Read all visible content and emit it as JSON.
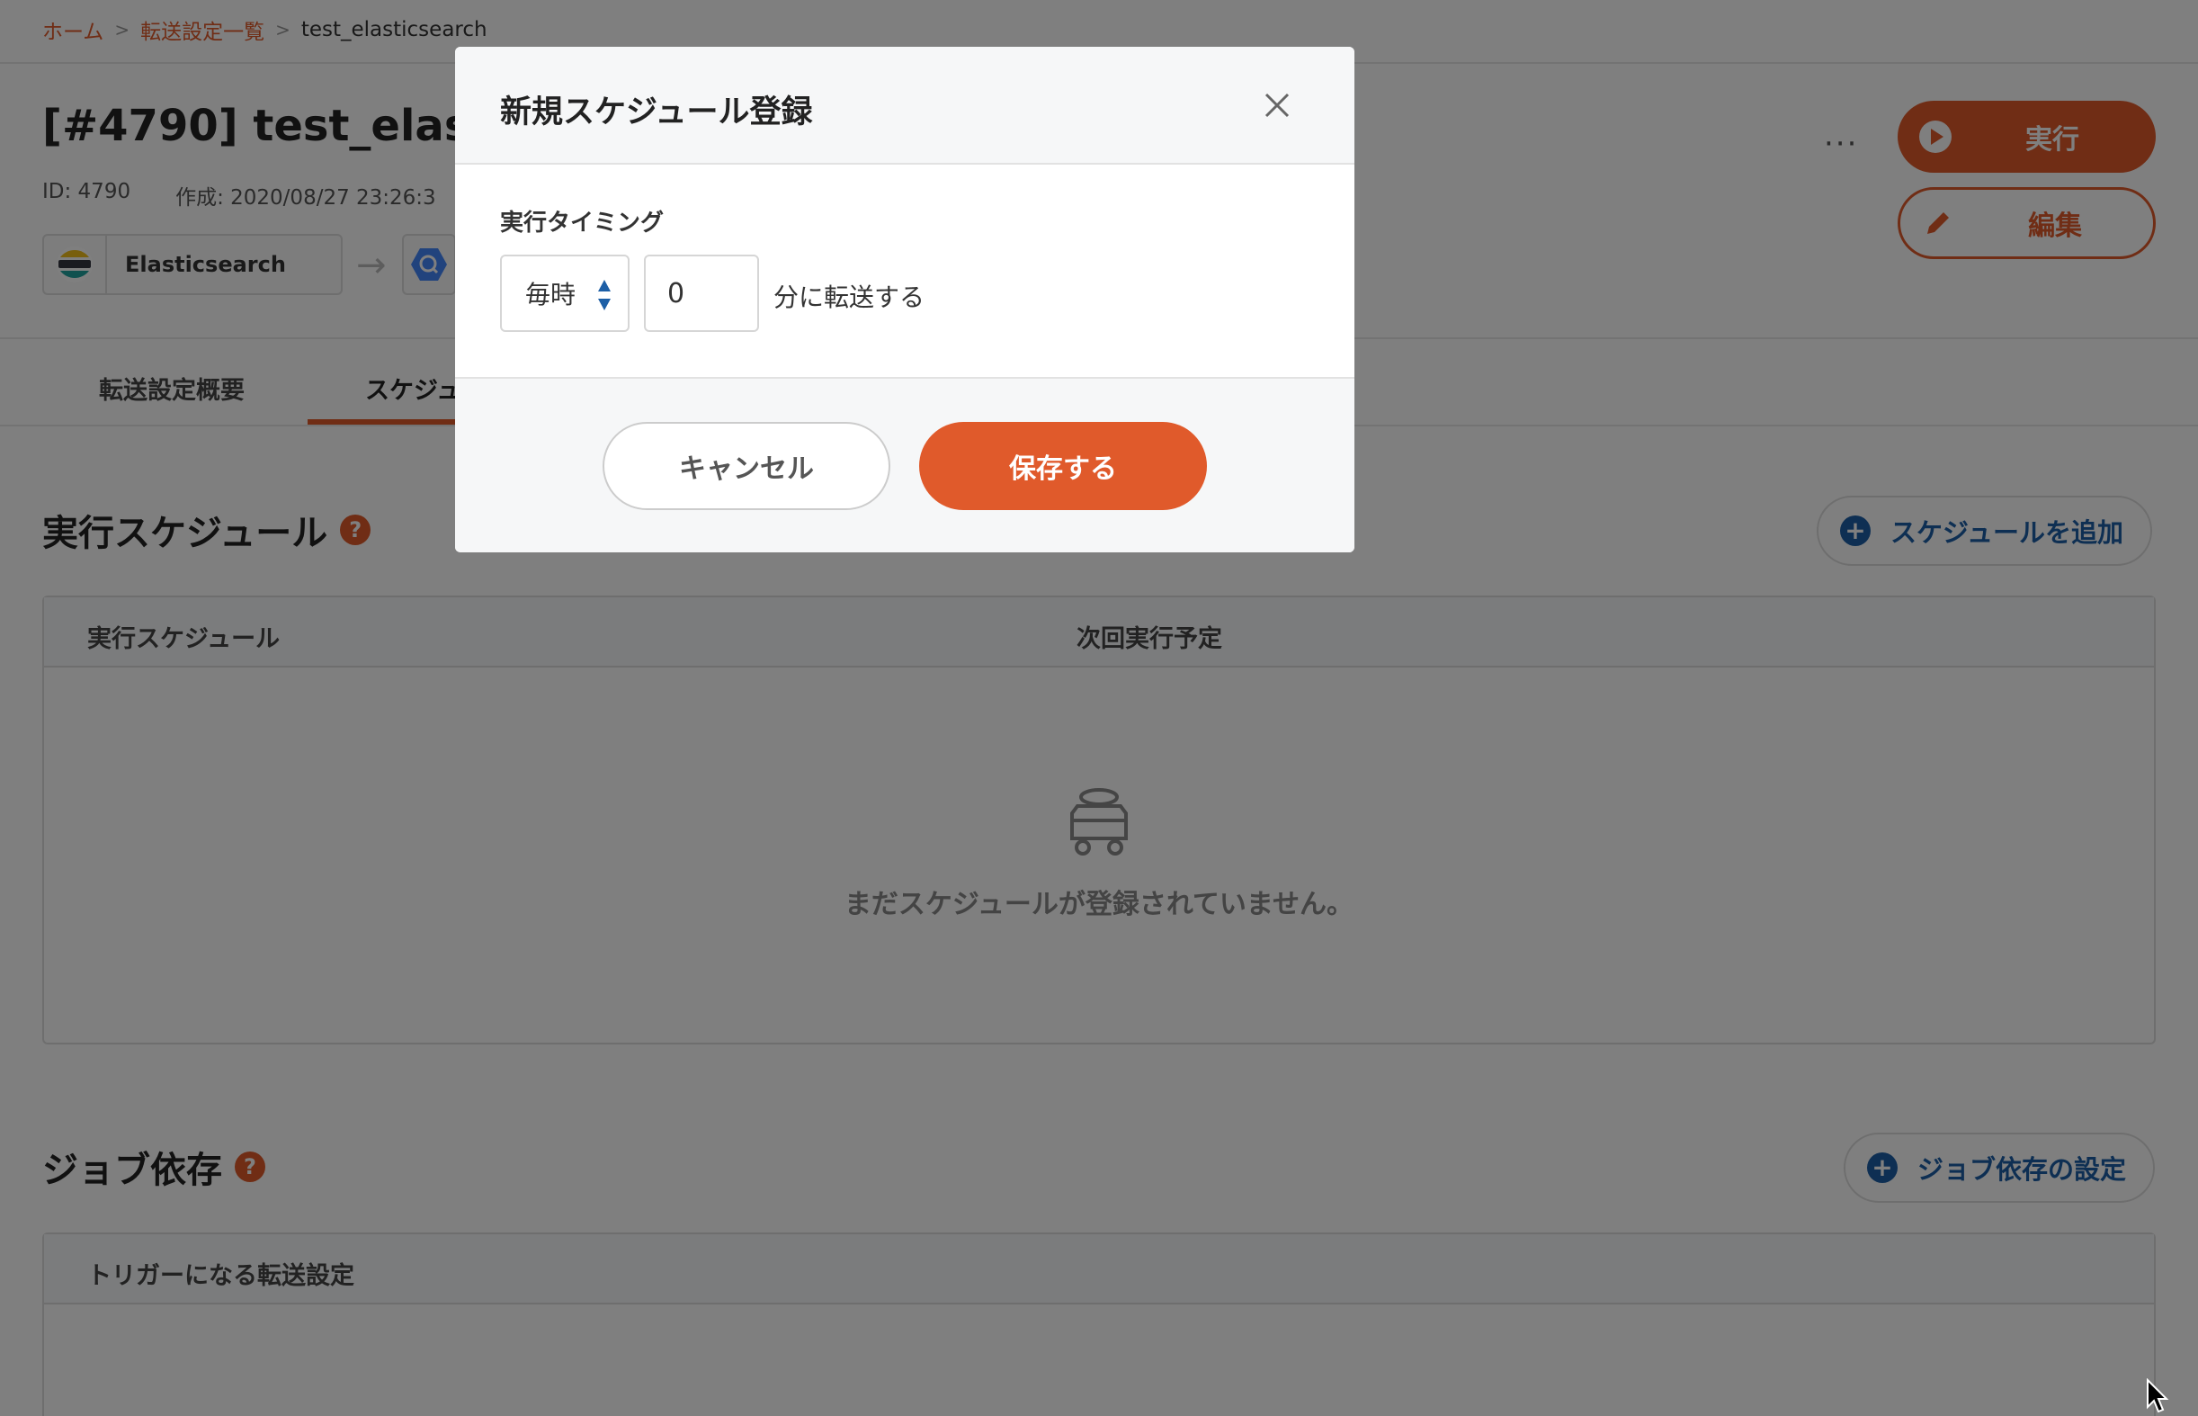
{
  "breadcrumb": {
    "home": "ホーム",
    "list": "転送設定一覧",
    "current": "test_elasticsearch",
    "separator": ">"
  },
  "header": {
    "title": "[#4790] test_elastic",
    "id_label": "ID: 4790",
    "created_label": "作成: 2020/08/27 23:26:3"
  },
  "connectors": {
    "source_label": "Elasticsearch",
    "arrow": "→"
  },
  "actions": {
    "more": "···",
    "run_label": "実行",
    "edit_label": "編集"
  },
  "tabs": [
    {
      "label": "転送設定概要",
      "active": false
    },
    {
      "label": "スケジュ",
      "active": true
    }
  ],
  "schedule_section": {
    "title": "実行スケジュール",
    "help": "?",
    "add_button": "スケジュールを追加",
    "columns": [
      "実行スケジュール",
      "次回実行予定"
    ],
    "empty_text": "まだスケジュールが登録されていません。"
  },
  "dependency_section": {
    "title": "ジョブ依存",
    "help": "?",
    "add_button": "ジョブ依存の設定",
    "columns": [
      "トリガーになる転送設定"
    ]
  },
  "modal": {
    "title": "新規スケジュール登録",
    "field_label": "実行タイミング",
    "frequency_value": "毎時",
    "minute_value": "0",
    "suffix": "分に転送する",
    "cancel_label": "キャンセル",
    "save_label": "保存する"
  },
  "colors": {
    "accent": "#e05a2b",
    "link_blue": "#1d5fa6",
    "overlay": "rgba(0,0,0,0.5)"
  },
  "icons": {
    "close": "close-icon",
    "play": "play-icon",
    "pencil": "pencil-icon",
    "plus": "plus-circle-icon",
    "help": "help-icon",
    "empty": "empty-cart-icon"
  }
}
